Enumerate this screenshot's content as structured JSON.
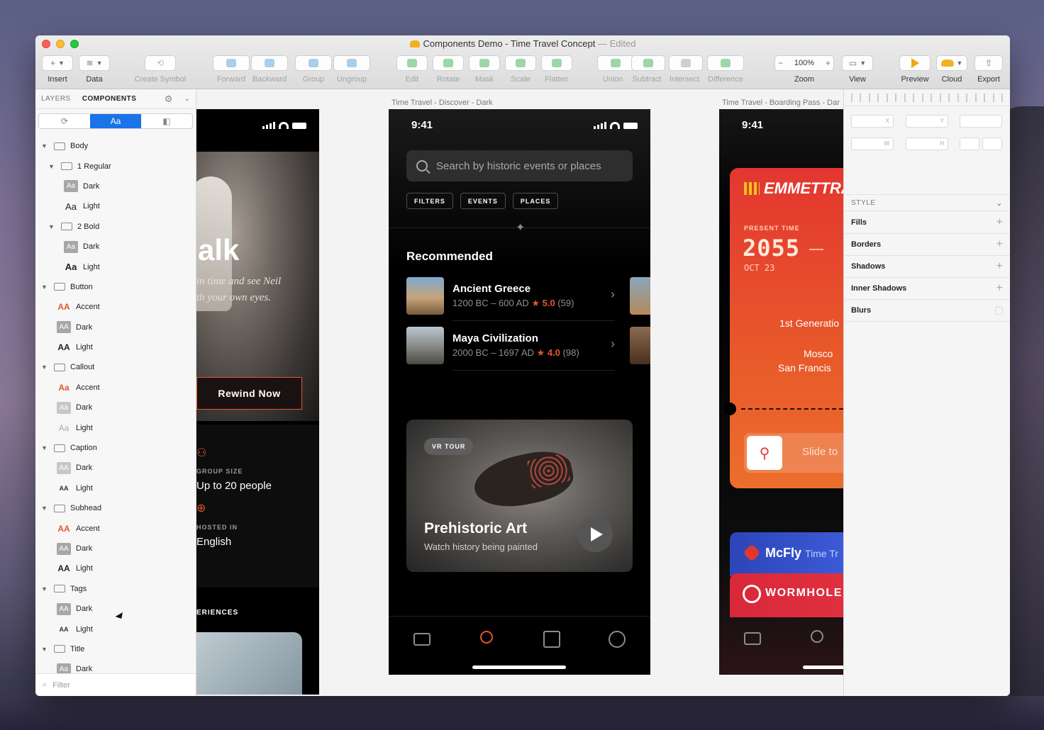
{
  "window": {
    "title": "Components Demo - Time Travel Concept",
    "edited": "— Edited"
  },
  "toolbar": {
    "insert": "Insert",
    "data": "Data",
    "create_symbol": "Create Symbol",
    "forward": "Forward",
    "backward": "Backward",
    "group": "Group",
    "ungroup": "Ungroup",
    "edit": "Edit",
    "rotate": "Rotate",
    "mask": "Mask",
    "scale": "Scale",
    "flatten": "Flatten",
    "union": "Union",
    "subtract": "Subtract",
    "intersect": "Intersect",
    "difference": "Difference",
    "zoom_value": "100%",
    "zoom": "Zoom",
    "view": "View",
    "preview": "Preview",
    "cloud": "Cloud",
    "export": "Export"
  },
  "left_panel": {
    "tab_layers": "LAYERS",
    "tab_components": "COMPONENTS",
    "seg_text": "Aa",
    "filter_placeholder": "Filter",
    "tree": [
      {
        "type": "group",
        "label": "Body",
        "indent": 0
      },
      {
        "type": "group",
        "label": "1 Regular",
        "indent": 1
      },
      {
        "type": "item",
        "label": "Dark",
        "glyph": "Aa",
        "style": "box",
        "indent": 2
      },
      {
        "type": "item",
        "label": "Light",
        "glyph": "Aa",
        "style": "plain",
        "indent": 2
      },
      {
        "type": "group",
        "label": "2 Bold",
        "indent": 1
      },
      {
        "type": "item",
        "label": "Dark",
        "glyph": "Aa",
        "style": "box",
        "indent": 2
      },
      {
        "type": "item",
        "label": "Light",
        "glyph": "Aa",
        "style": "plain-bold",
        "indent": 2
      },
      {
        "type": "group",
        "label": "Button",
        "indent": 0
      },
      {
        "type": "item",
        "label": "Accent",
        "glyph": "AA",
        "style": "accent",
        "indent": 1
      },
      {
        "type": "item",
        "label": "Dark",
        "glyph": "AA",
        "style": "box",
        "indent": 1
      },
      {
        "type": "item",
        "label": "Light",
        "glyph": "AA",
        "style": "bold",
        "indent": 1
      },
      {
        "type": "group",
        "label": "Callout",
        "indent": 0
      },
      {
        "type": "item",
        "label": "Accent",
        "glyph": "Aa",
        "style": "accent",
        "indent": 1
      },
      {
        "type": "item",
        "label": "Dark",
        "glyph": "Aa",
        "style": "pale-box",
        "indent": 1
      },
      {
        "type": "item",
        "label": "Light",
        "glyph": "Aa",
        "style": "pale",
        "indent": 1
      },
      {
        "type": "group",
        "label": "Caption",
        "indent": 0
      },
      {
        "type": "item",
        "label": "Dark",
        "glyph": "AA",
        "style": "pale-box",
        "indent": 1
      },
      {
        "type": "item",
        "label": "Light",
        "glyph": "AA",
        "style": "small",
        "indent": 1
      },
      {
        "type": "group",
        "label": "Subhead",
        "indent": 0
      },
      {
        "type": "item",
        "label": "Accent",
        "glyph": "AA",
        "style": "accent",
        "indent": 1
      },
      {
        "type": "item",
        "label": "Dark",
        "glyph": "AA",
        "style": "box",
        "indent": 1
      },
      {
        "type": "item",
        "label": "Light",
        "glyph": "AA",
        "style": "bold",
        "indent": 1
      },
      {
        "type": "group",
        "label": "Tags",
        "indent": 0
      },
      {
        "type": "item",
        "label": "Dark",
        "glyph": "AA",
        "style": "box",
        "indent": 1
      },
      {
        "type": "item",
        "label": "Light",
        "glyph": "AA",
        "style": "small",
        "indent": 1
      },
      {
        "type": "group",
        "label": "Title",
        "indent": 0
      },
      {
        "type": "item",
        "label": "Dark",
        "glyph": "Aa",
        "style": "box",
        "indent": 1
      }
    ]
  },
  "artboards": {
    "discover_title": "Time Travel - Discover - Dark",
    "boarding_title": "Time Travel - Boarding Pass - Dar"
  },
  "phone_left": {
    "headline": "alk",
    "subtitle_1": "in time and see Neil",
    "subtitle_2": "th your own eyes.",
    "button": "Rewind Now",
    "group_size_label": "GROUP SIZE",
    "group_size_value": "Up to 20 people",
    "hosted_label": "HOSTED IN",
    "hosted_value": "English",
    "experiences": "ERIENCES"
  },
  "phone_discover": {
    "time": "9:41",
    "search_placeholder": "Search by historic events or places",
    "chips": [
      "FILTERS",
      "EVENTS",
      "PLACES"
    ],
    "recommended": "Recommended",
    "items": [
      {
        "name": "Ancient Greece",
        "years": "1200 BC – 600 AD",
        "rating": "5.0",
        "count": "(59)"
      },
      {
        "name": "Maya Civilization",
        "years": "2000 BC – 1697 AD",
        "rating": "4.0",
        "count": "(98)"
      }
    ],
    "vr_badge": "VR TOUR",
    "vr_title": "Prehistoric Art",
    "vr_subtitle": "Watch history being painted"
  },
  "phone_boarding": {
    "time": "9:41",
    "airline": "EMMETTRA",
    "present_time": "PRESENT TIME",
    "year": "2055",
    "date": "OCT 23",
    "generation": "1st Generatio",
    "from_city": "Mosco",
    "to_city": "San Francis",
    "slide": "Slide to",
    "mcfly": "McFly",
    "mcfly_sub": "Time Tr",
    "wormhole": "WORMHOLE"
  },
  "inspector": {
    "style": "STYLE",
    "fills": "Fills",
    "borders": "Borders",
    "shadows": "Shadows",
    "inner_shadows": "Inner Shadows",
    "blurs": "Blurs",
    "x": "X",
    "y": "Y",
    "w": "W",
    "h": "H"
  },
  "colors": {
    "accent": "#e0582c",
    "selection": "#1a73e8",
    "ticket_red": "#e33630"
  }
}
